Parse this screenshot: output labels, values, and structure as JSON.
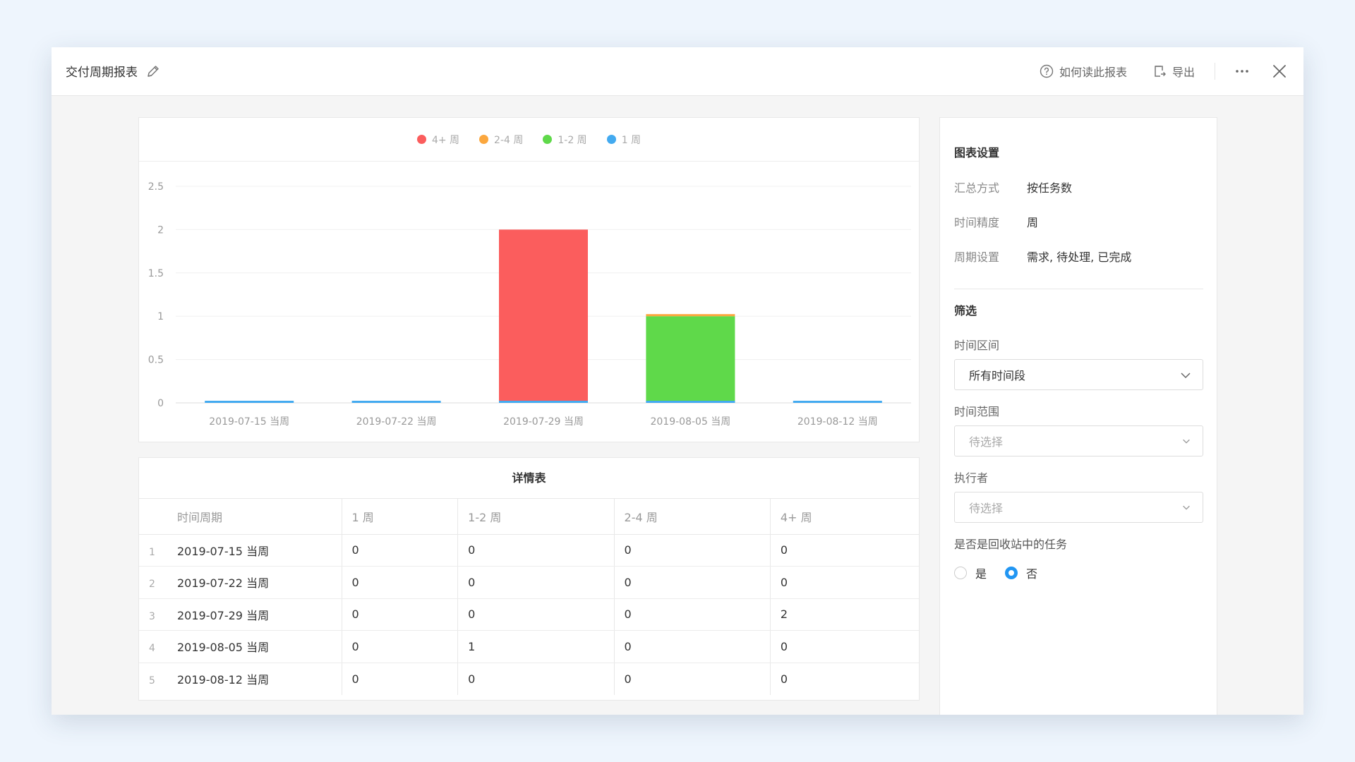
{
  "window": {
    "title": "交付周期报表",
    "toolbar": {
      "help_label": "如何读此报表",
      "export_label": "导出"
    }
  },
  "colors": {
    "accent": "#2196f3",
    "series_4plus": "#fb5d5d",
    "series_2_4": "#fba73e",
    "series_1_2": "#5fd94a",
    "series_1": "#43aaf0"
  },
  "chart_data": {
    "type": "bar",
    "stacked": true,
    "categories": [
      "2019-07-15 当周",
      "2019-07-22 当周",
      "2019-07-29 当周",
      "2019-08-05 当周",
      "2019-08-12 当周"
    ],
    "series": [
      {
        "name": "1 周",
        "color": "#43aaf0",
        "values": [
          0,
          0,
          0,
          0,
          0
        ]
      },
      {
        "name": "1-2 周",
        "color": "#5fd94a",
        "values": [
          0,
          0,
          0,
          1,
          0
        ]
      },
      {
        "name": "2-4 周",
        "color": "#fba73e",
        "values": [
          0,
          0,
          0,
          0,
          0
        ]
      },
      {
        "name": "4+ 周",
        "color": "#fb5d5d",
        "values": [
          0,
          0,
          2,
          0,
          0
        ]
      }
    ],
    "legend_order": [
      "4+ 周",
      "2-4 周",
      "1-2 周",
      "1 周"
    ],
    "yticks": [
      "0",
      "0.5",
      "1",
      "1.5",
      "2",
      "2.5"
    ],
    "ylim": [
      0,
      2.5
    ],
    "legend_position": "top-center",
    "grid": true
  },
  "table": {
    "title": "详情表",
    "columns": [
      "时间周期",
      "1 周",
      "1-2 周",
      "2-4 周",
      "4+ 周"
    ],
    "rows": [
      {
        "index": "1",
        "cells": [
          "2019-07-15 当周",
          "0",
          "0",
          "0",
          "0"
        ]
      },
      {
        "index": "2",
        "cells": [
          "2019-07-22 当周",
          "0",
          "0",
          "0",
          "0"
        ]
      },
      {
        "index": "3",
        "cells": [
          "2019-07-29 当周",
          "0",
          "0",
          "0",
          "2"
        ]
      },
      {
        "index": "4",
        "cells": [
          "2019-08-05 当周",
          "0",
          "1",
          "0",
          "0"
        ]
      },
      {
        "index": "5",
        "cells": [
          "2019-08-12 当周",
          "0",
          "0",
          "0",
          "0"
        ]
      }
    ]
  },
  "settings": {
    "heading": "图表设置",
    "items": [
      {
        "key": "汇总方式",
        "value": "按任务数"
      },
      {
        "key": "时间精度",
        "value": "周"
      },
      {
        "key": "周期设置",
        "value": "需求, 待处理, 已完成"
      }
    ]
  },
  "filters": {
    "heading": "筛选",
    "time_interval": {
      "label": "时间区间",
      "value": "所有时间段"
    },
    "time_range": {
      "label": "时间范围",
      "placeholder": "待选择"
    },
    "assignee": {
      "label": "执行者",
      "placeholder": "待选择"
    },
    "recycle": {
      "label": "是否是回收站中的任务",
      "options": [
        {
          "label": "是",
          "selected": false
        },
        {
          "label": "否",
          "selected": true
        }
      ]
    }
  }
}
